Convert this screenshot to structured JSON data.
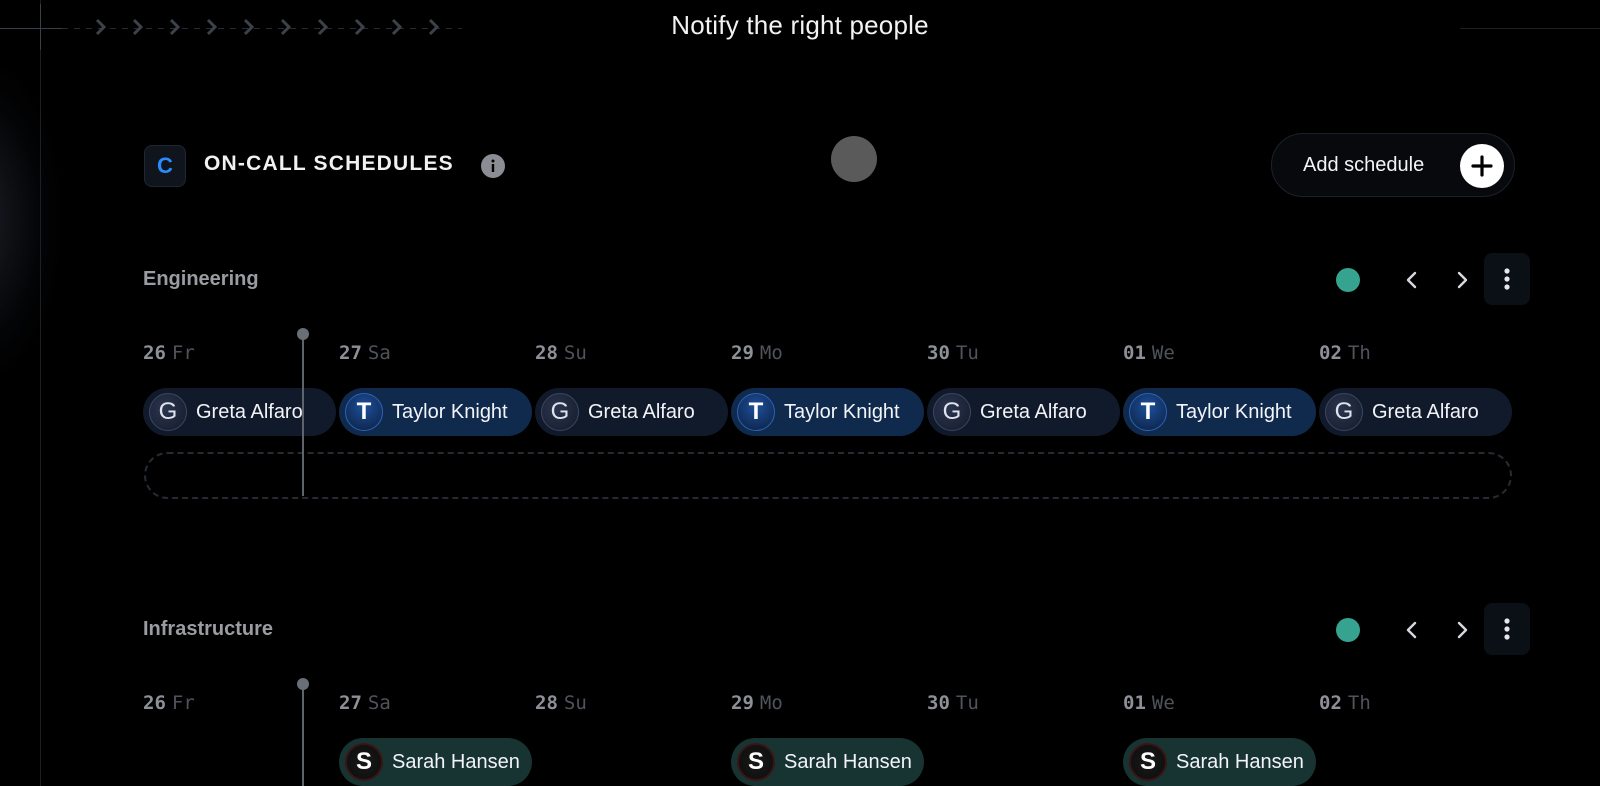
{
  "headline": "Notify the right people",
  "header": {
    "logo_letter": "C",
    "title": "ON-CALL SCHEDULES",
    "add_button_label": "Add schedule"
  },
  "colors": {
    "accent_blue": "#2a8bff",
    "status_active": "#35a38f",
    "taylor_shift": "#102a4d",
    "greta_shift": "#111a2a",
    "sarah_shift": "#173432"
  },
  "icons": [
    "info-icon",
    "plus-icon",
    "chevron-left-icon",
    "chevron-right-icon",
    "more-vertical-icon"
  ],
  "schedules": [
    {
      "name": "Engineering",
      "days": [
        {
          "num": "26",
          "wd": "Fr"
        },
        {
          "num": "27",
          "wd": "Sa"
        },
        {
          "num": "28",
          "wd": "Su"
        },
        {
          "num": "29",
          "wd": "Mo"
        },
        {
          "num": "30",
          "wd": "Tu"
        },
        {
          "num": "01",
          "wd": "We"
        },
        {
          "num": "02",
          "wd": "Th"
        }
      ],
      "shifts": [
        {
          "name": "Greta Alfaro",
          "initial": "G"
        },
        {
          "name": "Taylor Knight",
          "initial": "T"
        },
        {
          "name": "Greta Alfaro",
          "initial": "G"
        },
        {
          "name": "Taylor Knight",
          "initial": "T"
        },
        {
          "name": "Greta Alfaro",
          "initial": "G"
        },
        {
          "name": "Taylor Knight",
          "initial": "T"
        },
        {
          "name": "Greta Alfaro",
          "initial": "G"
        }
      ]
    },
    {
      "name": "Infrastructure",
      "days": [
        {
          "num": "26",
          "wd": "Fr"
        },
        {
          "num": "27",
          "wd": "Sa"
        },
        {
          "num": "28",
          "wd": "Su"
        },
        {
          "num": "29",
          "wd": "Mo"
        },
        {
          "num": "30",
          "wd": "Tu"
        },
        {
          "num": "01",
          "wd": "We"
        },
        {
          "num": "02",
          "wd": "Th"
        }
      ],
      "shifts": [
        {
          "name": "Sarah Hansen",
          "initial": "S"
        },
        {
          "name": "Sarah Hansen",
          "initial": "S"
        },
        {
          "name": "Sarah Hansen",
          "initial": "S"
        }
      ]
    }
  ]
}
